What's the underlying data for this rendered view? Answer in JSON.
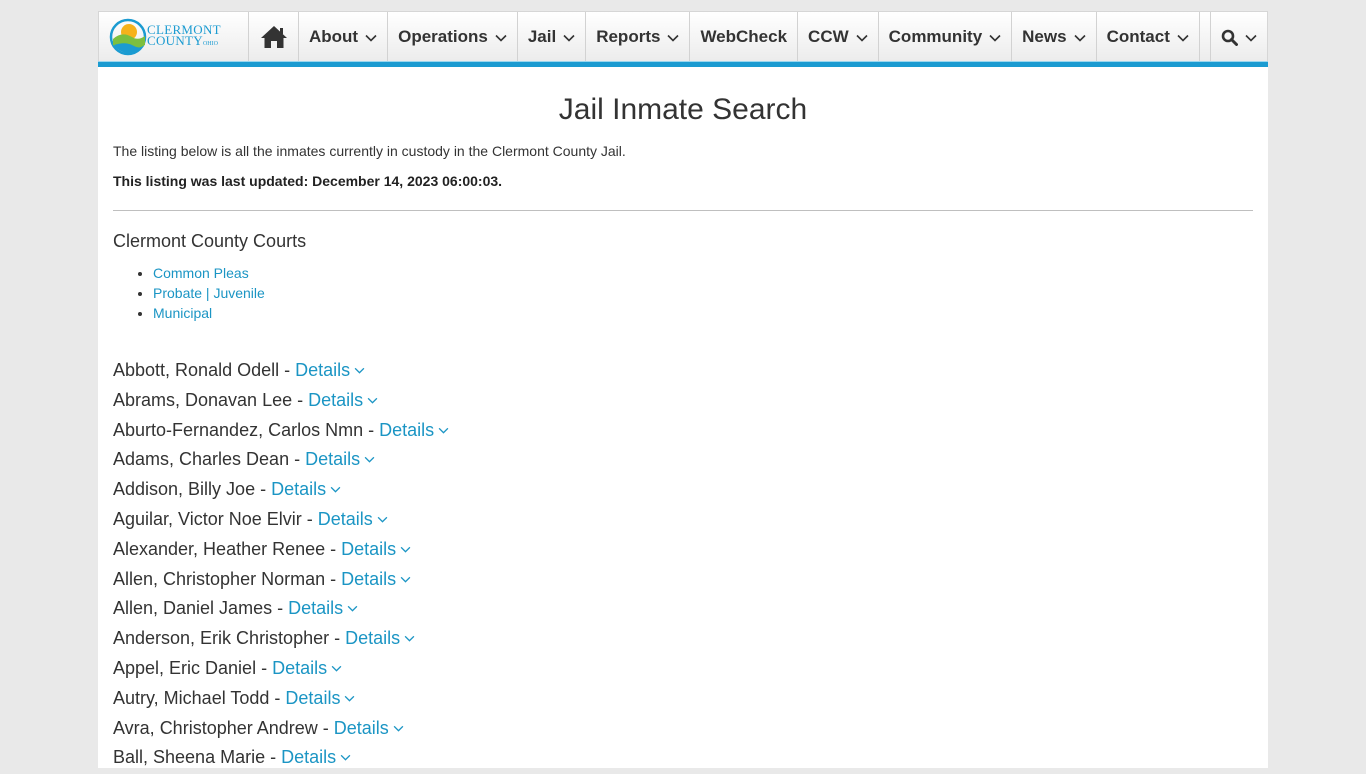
{
  "logo": {
    "line1": "CLERMONT",
    "line2": "COUNTY",
    "line3": "OHIO"
  },
  "nav": {
    "items": [
      {
        "label": "About"
      },
      {
        "label": "Operations"
      },
      {
        "label": "Jail"
      },
      {
        "label": "Reports"
      },
      {
        "label": "WebCheck"
      },
      {
        "label": "CCW"
      },
      {
        "label": "Community"
      },
      {
        "label": "News"
      },
      {
        "label": "Contact"
      }
    ],
    "icons": {
      "home": "home-icon",
      "search": "search-icon",
      "chevron": "chevron-down-icon"
    },
    "accent_color": "#1b9bd1"
  },
  "page": {
    "title": "Jail Inmate Search",
    "intro": "The listing below is all the inmates currently in custody in the Clermont County Jail.",
    "updated": "This listing was last updated: December 14, 2023 06:00:03."
  },
  "courts": {
    "title": "Clermont County Courts",
    "links": [
      "Common Pleas",
      "Probate | Juvenile",
      "Municipal"
    ]
  },
  "inmates": {
    "separator": " - ",
    "details_label": "Details",
    "link_color": "#1b95c4",
    "names": [
      "Abbott, Ronald Odell",
      "Abrams, Donavan Lee",
      "Aburto-Fernandez, Carlos Nmn",
      "Adams, Charles Dean",
      "Addison, Billy Joe",
      "Aguilar, Victor Noe Elvir",
      "Alexander, Heather Renee",
      "Allen, Christopher Norman",
      "Allen, Daniel James",
      "Anderson, Erik Christopher",
      "Appel, Eric Daniel",
      "Autry, Michael Todd",
      "Avra, Christopher Andrew",
      "Ball, Sheena Marie"
    ]
  }
}
